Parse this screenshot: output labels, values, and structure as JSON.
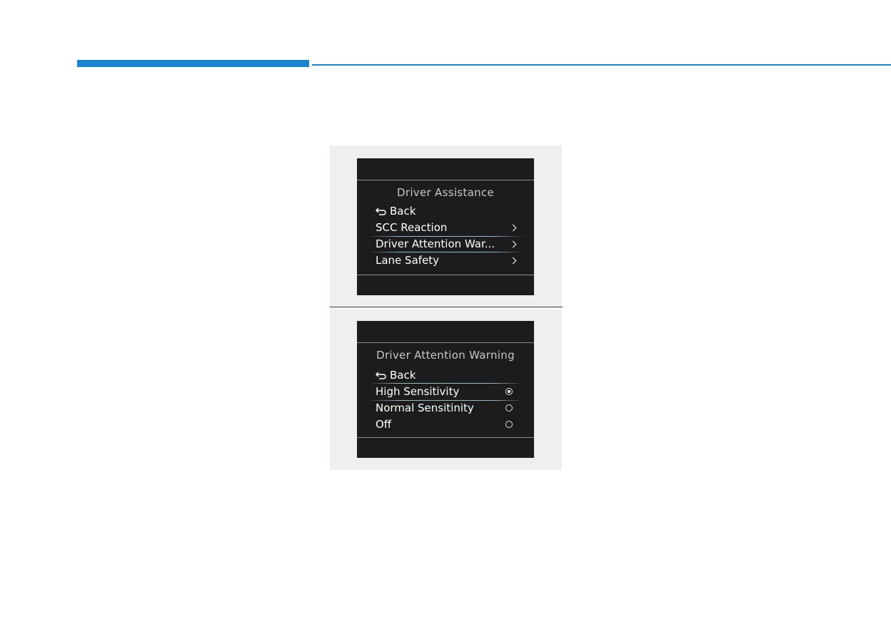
{
  "screen1": {
    "title": "Driver Assistance",
    "back_label": "Back",
    "items": [
      {
        "label": "SCC Reaction"
      },
      {
        "label": "Driver Attention War..."
      },
      {
        "label": "Lane Safety"
      }
    ]
  },
  "screen2": {
    "title": "Driver Attention Warning",
    "back_label": "Back",
    "options": [
      {
        "label": "High Sensitivity",
        "selected": true
      },
      {
        "label": "Normal Sensitinity",
        "selected": false
      },
      {
        "label": "Off",
        "selected": false
      }
    ]
  },
  "colors": {
    "accent": "#1a85cf",
    "screen_bg": "#1c1c1c",
    "panel_bg": "#efefef"
  }
}
